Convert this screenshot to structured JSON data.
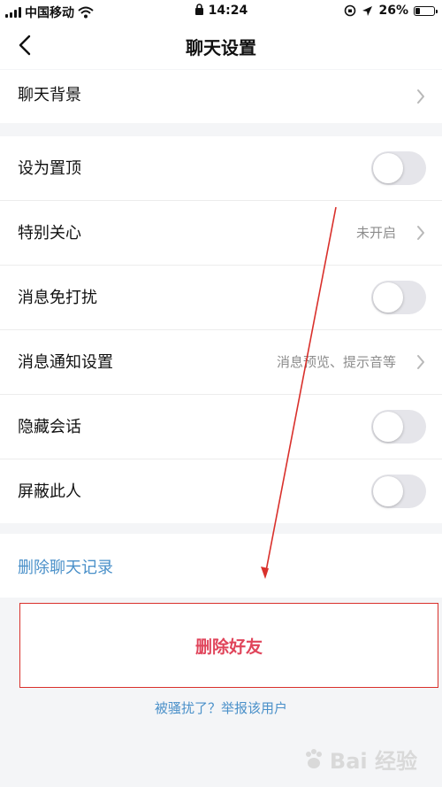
{
  "status_bar": {
    "carrier": "中国移动",
    "time": "14:24",
    "battery": "26%",
    "battery_level": 0.26
  },
  "nav": {
    "title": "聊天设置",
    "back_icon": "chevron-left-icon"
  },
  "sections": {
    "background": {
      "label": "聊天背景"
    },
    "settings": [
      {
        "label": "设为置顶",
        "type": "toggle",
        "on": false
      },
      {
        "label": "特别关心",
        "type": "link",
        "value": "未开启"
      },
      {
        "label": "消息免打扰",
        "type": "toggle",
        "on": false
      },
      {
        "label": "消息通知设置",
        "type": "link",
        "value": "消息预览、提示音等"
      },
      {
        "label": "隐藏会话",
        "type": "toggle",
        "on": false
      },
      {
        "label": "屏蔽此人",
        "type": "toggle",
        "on": false
      }
    ],
    "clear_history": {
      "label": "删除聊天记录"
    },
    "delete_friend": {
      "label": "删除好友"
    },
    "report": {
      "label": "被骚扰了？举报该用户"
    }
  },
  "watermark": {
    "text": "Bai 经验"
  },
  "colors": {
    "link": "#4a90c9",
    "danger": "#e0455b",
    "annotation": "#d9302b",
    "toggle_off": "#e5e5ea"
  }
}
